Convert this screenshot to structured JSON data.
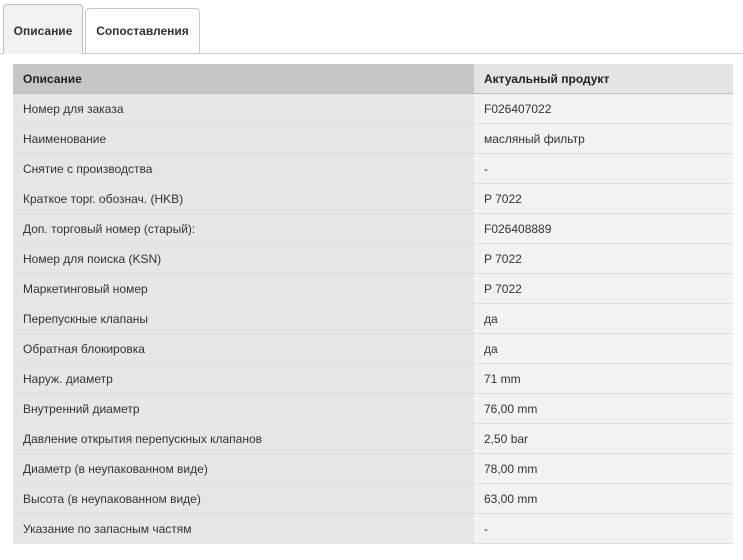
{
  "tabs": [
    {
      "label": "Описание",
      "active": true
    },
    {
      "label": "Сопоставления",
      "active": false
    }
  ],
  "table": {
    "headers": [
      "Описание",
      "Актуальный продукт"
    ],
    "rows": [
      [
        "Номер для заказа",
        "F026407022"
      ],
      [
        "Наименование",
        "масляный фильтр"
      ],
      [
        "Снятие с производства",
        "-"
      ],
      [
        "Краткое торг. обознач. (HKB)",
        "P 7022"
      ],
      [
        "Доп. торговый номер (старый):",
        "F026408889"
      ],
      [
        "Номер для поиска (KSN)",
        "P 7022"
      ],
      [
        "Маркетинговый номер",
        "P 7022"
      ],
      [
        "Перепускные клапаны",
        "да"
      ],
      [
        "Обратная блокировка",
        "да"
      ],
      [
        "Наруж. диаметр",
        "71 mm"
      ],
      [
        "Внутренний диаметр",
        "76,00 mm"
      ],
      [
        "Давление открытия перепускных клапанов",
        "2,50 bar"
      ],
      [
        "Диаметр (в неупакованном виде)",
        "78,00 mm"
      ],
      [
        "Высота (в неупакованном виде)",
        "63,00 mm"
      ],
      [
        "Указание по запасным частям",
        "-"
      ]
    ]
  },
  "colors": {
    "header_bg": "#c6c6c6",
    "label_bg": "#e6e6e6",
    "value_bg": "#f2f2f2",
    "border": "#c8c8c8"
  }
}
